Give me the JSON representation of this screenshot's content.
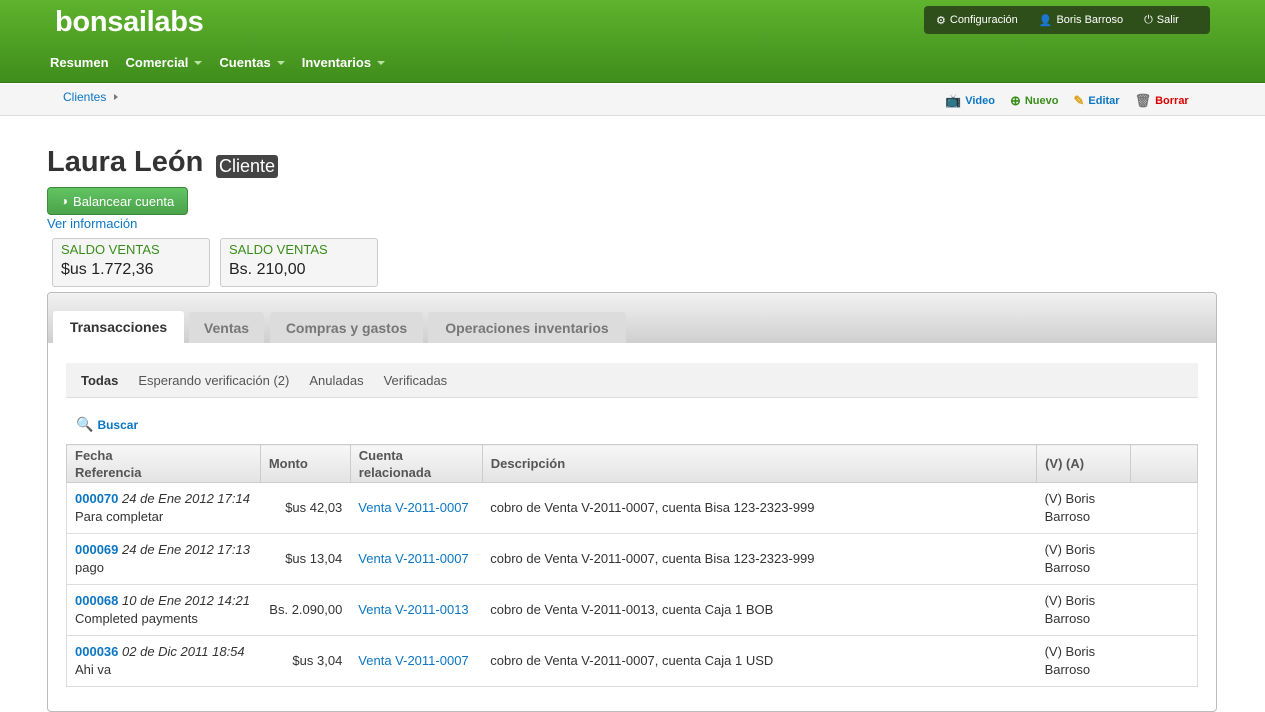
{
  "brand": "bonsailabs",
  "nav": [
    "Resumen",
    "Comercial",
    "Cuentas",
    "Inventarios"
  ],
  "user_menu": {
    "config": "Configuración",
    "user": "Boris Barroso",
    "logout": "Salir"
  },
  "breadcrumb": "Clientes",
  "actions": {
    "video": "Video",
    "nuevo": "Nuevo",
    "editar": "Editar",
    "borrar": "Borrar"
  },
  "page": {
    "title": "Laura León",
    "badge": "Cliente",
    "balance_button": "Balancear cuenta",
    "ver_info": "Ver información"
  },
  "stats": [
    {
      "label": "SALDO VENTAS",
      "value": "$us 1.772,36"
    },
    {
      "label": "SALDO VENTAS",
      "value": "Bs. 210,00"
    }
  ],
  "tabs": [
    "Transacciones",
    "Ventas",
    "Compras y gastos",
    "Operaciones inventarios"
  ],
  "filters": [
    "Todas",
    "Esperando verificación (2)",
    "Anuladas",
    "Verificadas"
  ],
  "search_label": "Buscar",
  "table": {
    "headers": {
      "fecha": "Fecha",
      "referencia": "Referencia",
      "monto": "Monto",
      "cuenta1": "Cuenta",
      "cuenta2": "relacionada",
      "descripcion": "Descripción",
      "va": "(V) (A)"
    },
    "rows": [
      {
        "ref": "000070",
        "fecha": "24 de Ene 2012 17:14",
        "nota": "Para completar",
        "monto": "$us 42,03",
        "cuenta": "Venta V-2011-0007",
        "desc": "cobro de Venta V-2011-0007, cuenta Bisa 123-2323-999",
        "va1": "(V) Boris",
        "va2": "Barroso"
      },
      {
        "ref": "000069",
        "fecha": "24 de Ene 2012 17:13",
        "nota": "pago",
        "monto": "$us 13,04",
        "cuenta": "Venta V-2011-0007",
        "desc": "cobro de Venta V-2011-0007, cuenta Bisa 123-2323-999",
        "va1": "(V) Boris",
        "va2": "Barroso"
      },
      {
        "ref": "000068",
        "fecha": "10 de Ene 2012 14:21",
        "nota": "Completed payments",
        "monto": "Bs. 2.090,00",
        "cuenta": "Venta V-2011-0013",
        "desc": "cobro de Venta V-2011-0013, cuenta Caja 1 BOB",
        "va1": "(V) Boris",
        "va2": "Barroso"
      },
      {
        "ref": "000036",
        "fecha": "02 de Dic 2011 18:54",
        "nota": "Ahi va",
        "monto": "$us 3,04",
        "cuenta": "Venta V-2011-0007",
        "desc": "cobro de Venta V-2011-0007, cuenta Caja 1 USD",
        "va1": "(V) Boris",
        "va2": "Barroso"
      }
    ]
  }
}
